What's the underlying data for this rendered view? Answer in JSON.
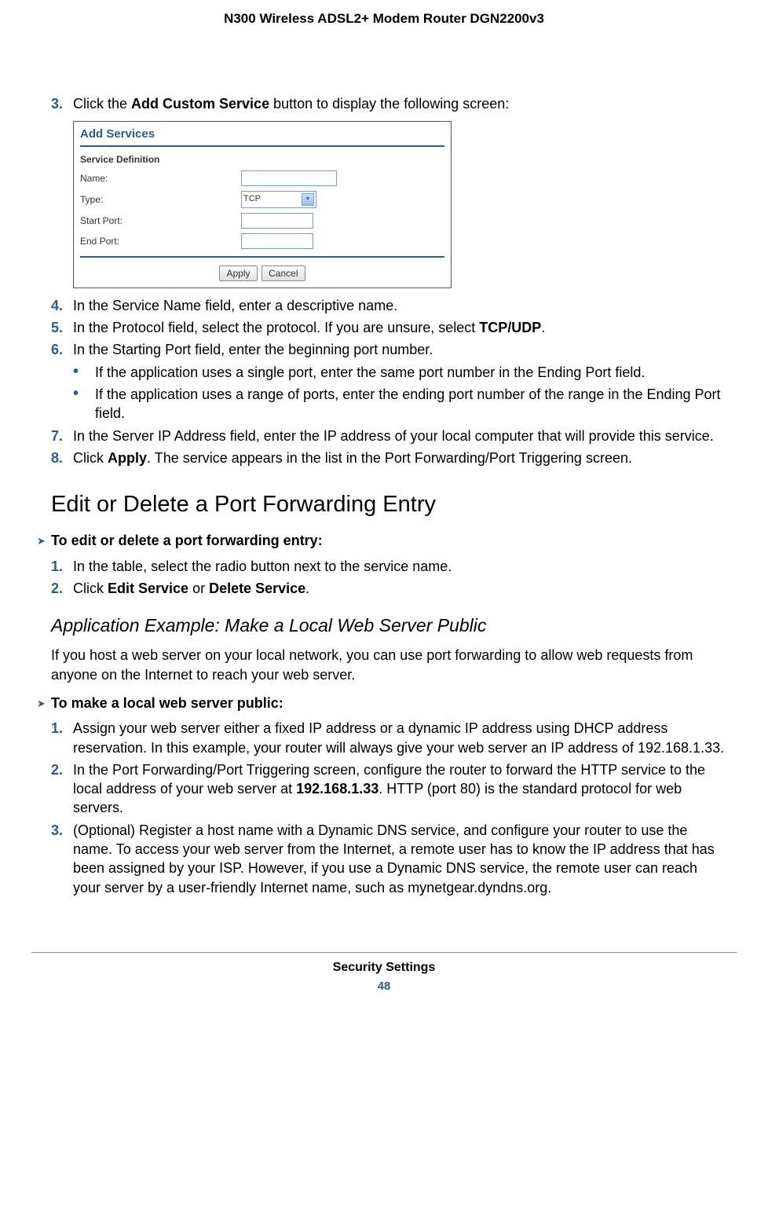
{
  "header": {
    "title": "N300 Wireless ADSL2+ Modem Router DGN2200v3"
  },
  "steps": {
    "s3_pre": "Click the ",
    "s3_bold": "Add Custom Service",
    "s3_post": " button to display the following screen:",
    "s4": "In the Service Name field, enter a descriptive name.",
    "s5_pre": "In the Protocol field, select the protocol. If you are unsure, select ",
    "s5_bold": "TCP/UDP",
    "s5_post": ".",
    "s6": "In the Starting Port field, enter the beginning port number.",
    "s6_b1": "If the application uses a single port, enter the same port number in the Ending Port field.",
    "s6_b2": "If the application uses a range of ports, enter the ending port number of the range in the Ending Port field.",
    "s7": "In the Server IP Address field, enter the IP address of your local computer that will provide this service.",
    "s8_pre": "Click ",
    "s8_bold": "Apply",
    "s8_post": ". The service appears in the list in the Port Forwarding/Port Triggering screen."
  },
  "h2": "Edit or Delete a Port Forwarding Entry",
  "task1": {
    "title": "To edit or delete a port forwarding entry:",
    "s1": "In the table, select the radio button next to the service name.",
    "s2_pre": "Click ",
    "s2_b1": "Edit Service",
    "s2_mid": " or ",
    "s2_b2": "Delete Service",
    "s2_post": "."
  },
  "h3": "Application Example: Make a Local Web Server Public",
  "intro": "If you host a web server on your local network, you can use port forwarding to allow web requests from anyone on the Internet to reach your web server.",
  "task2": {
    "title": "To make a local web server public:",
    "s1": "Assign your web server either a fixed IP address or a dynamic IP address using DHCP address reservation. In this example, your router will always give your web server an IP address of 192.168.1.33.",
    "s2_pre": "In the Port Forwarding/Port Triggering screen, configure the router to forward the HTTP service to the local address of your web server at ",
    "s2_bold": "192.168.1.33",
    "s2_post": ". HTTP (port 80) is the standard protocol for web servers.",
    "s3": "(Optional) Register a host name with a Dynamic DNS service, and configure your router to use the name. To access your web server from the Internet, a remote user has to know the IP address that has been assigned by your ISP. However, if you use a Dynamic DNS service, the remote user can reach your server by a user-friendly Internet name, such as mynetgear.dyndns.org."
  },
  "dialog": {
    "title": "Add Services",
    "sub": "Service Definition",
    "name_label": "Name:",
    "type_label": "Type:",
    "type_value": "TCP",
    "start_label": "Start Port:",
    "end_label": "End Port:",
    "apply": "Apply",
    "cancel": "Cancel"
  },
  "footer": {
    "section": "Security Settings",
    "page": "48"
  },
  "nums": {
    "n3": "3.",
    "n4": "4.",
    "n5": "5.",
    "n6": "6.",
    "n7": "7.",
    "n8": "8.",
    "n1": "1.",
    "n2": "2.",
    "na3": "3."
  },
  "bullet": "•",
  "arrow": "➤"
}
